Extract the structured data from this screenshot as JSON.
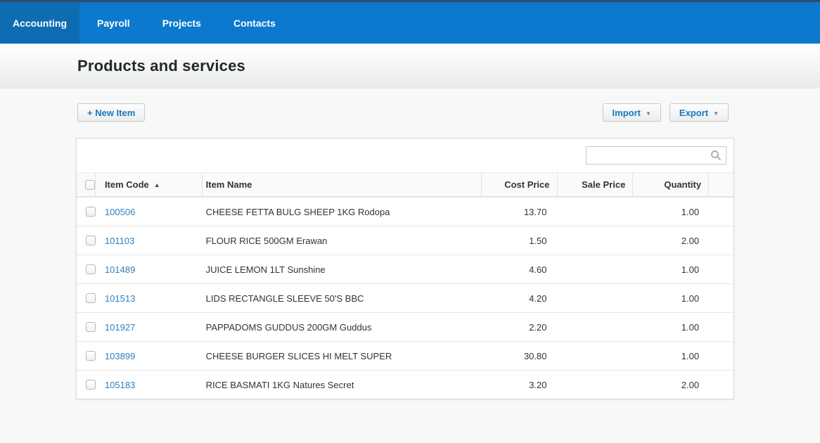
{
  "nav": {
    "tabs": [
      {
        "label": "Accounting",
        "active": true
      },
      {
        "label": "Payroll",
        "active": false
      },
      {
        "label": "Projects",
        "active": false
      },
      {
        "label": "Contacts",
        "active": false
      }
    ]
  },
  "page": {
    "title": "Products and services"
  },
  "toolbar": {
    "new_item_label": "+ New Item",
    "import_label": "Import",
    "export_label": "Export",
    "caret": "▼"
  },
  "search": {
    "placeholder": "",
    "value": "",
    "icon": "magnifier-icon"
  },
  "table": {
    "columns": {
      "item_code": "Item Code",
      "sort_indicator": "▲",
      "item_name": "Item Name",
      "cost_price": "Cost Price",
      "sale_price": "Sale Price",
      "quantity": "Quantity"
    },
    "sorted_by": "Item Code ascending",
    "rows": [
      {
        "code": "100506",
        "name": "CHEESE FETTA BULG SHEEP 1KG Rodopa",
        "cost_price": "13.70",
        "sale_price": "",
        "quantity": "1.00"
      },
      {
        "code": "101103",
        "name": "FLOUR RICE 500GM Erawan",
        "cost_price": "1.50",
        "sale_price": "",
        "quantity": "2.00"
      },
      {
        "code": "101489",
        "name": "JUICE LEMON 1LT Sunshine",
        "cost_price": "4.60",
        "sale_price": "",
        "quantity": "1.00"
      },
      {
        "code": "101513",
        "name": "LIDS RECTANGLE SLEEVE 50'S BBC",
        "cost_price": "4.20",
        "sale_price": "",
        "quantity": "1.00"
      },
      {
        "code": "101927",
        "name": "PAPPADOMS GUDDUS 200GM Guddus",
        "cost_price": "2.20",
        "sale_price": "",
        "quantity": "1.00"
      },
      {
        "code": "103899",
        "name": "CHEESE BURGER SLICES HI MELT SUPER",
        "cost_price": "30.80",
        "sale_price": "",
        "quantity": "1.00"
      },
      {
        "code": "105183",
        "name": "RICE BASMATI 1KG Natures Secret",
        "cost_price": "3.20",
        "sale_price": "",
        "quantity": "2.00"
      }
    ]
  },
  "colors": {
    "top_strip": "#2e4d6b",
    "nav_blue": "#0b79cd",
    "nav_active_blue": "#0e6cb3",
    "link_blue": "#2e81c0",
    "header_link_blue": "#1b7dc0",
    "button_text_blue": "#1878be"
  }
}
